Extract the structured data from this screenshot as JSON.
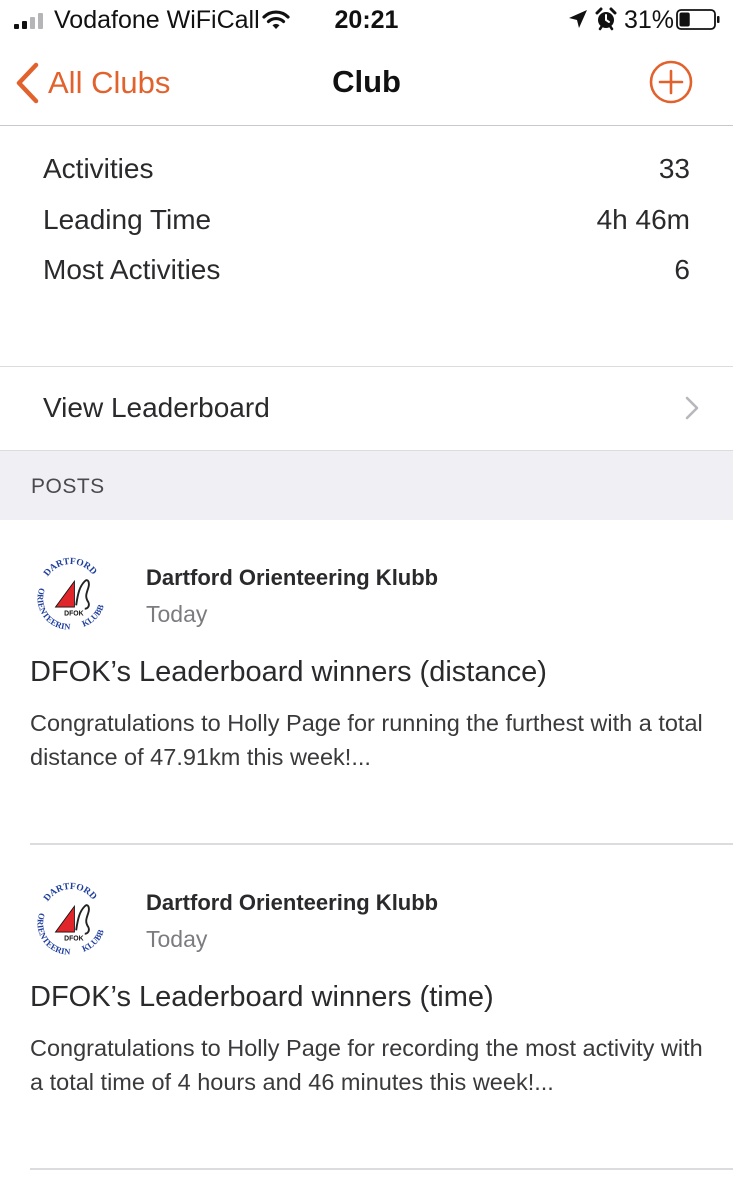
{
  "status_bar": {
    "carrier": "Vodafone WiFiCall",
    "time": "20:21",
    "battery_percent": "31%",
    "battery_level": 0.31,
    "signal_bars": 2,
    "icons": [
      "signal-icon",
      "wifi-icon",
      "location-arrow-icon",
      "alarm-icon",
      "battery-icon"
    ]
  },
  "nav": {
    "back_label": "All Clubs",
    "title": "Club",
    "add_icon": "plus-circle-icon"
  },
  "colors": {
    "accent": "#e2622e",
    "section_bg": "#efeff4",
    "divider": "#dcdcdf"
  },
  "stats": [
    {
      "label": "Activities",
      "value": "33"
    },
    {
      "label": "Leading Time",
      "value": "4h 46m"
    },
    {
      "label": "Most Activities",
      "value": "6"
    }
  ],
  "leaderboard": {
    "label": "View Leaderboard"
  },
  "posts_header": "POSTS",
  "posts": [
    {
      "logo": {
        "top_text": "DARTFORD",
        "left_text": "ORIENTEERING",
        "right_text": "KLUBB",
        "center_text": "DFOK"
      },
      "author": "Dartford Orienteering Klubb",
      "date": "Today",
      "title": "DFOK’s Leaderboard winners (distance)",
      "body": "Congratulations to Holly Page for running the furthest with a total distance of 47.91km this week!..."
    },
    {
      "logo": {
        "top_text": "DARTFORD",
        "left_text": "ORIENTEERING",
        "right_text": "KLUBB",
        "center_text": "DFOK"
      },
      "author": "Dartford Orienteering Klubb",
      "date": "Today",
      "title": "DFOK’s Leaderboard winners (time)",
      "body": "Congratulations to Holly Page for recording the most activity with a total time of 4 hours and 46 minutes this week!..."
    }
  ]
}
